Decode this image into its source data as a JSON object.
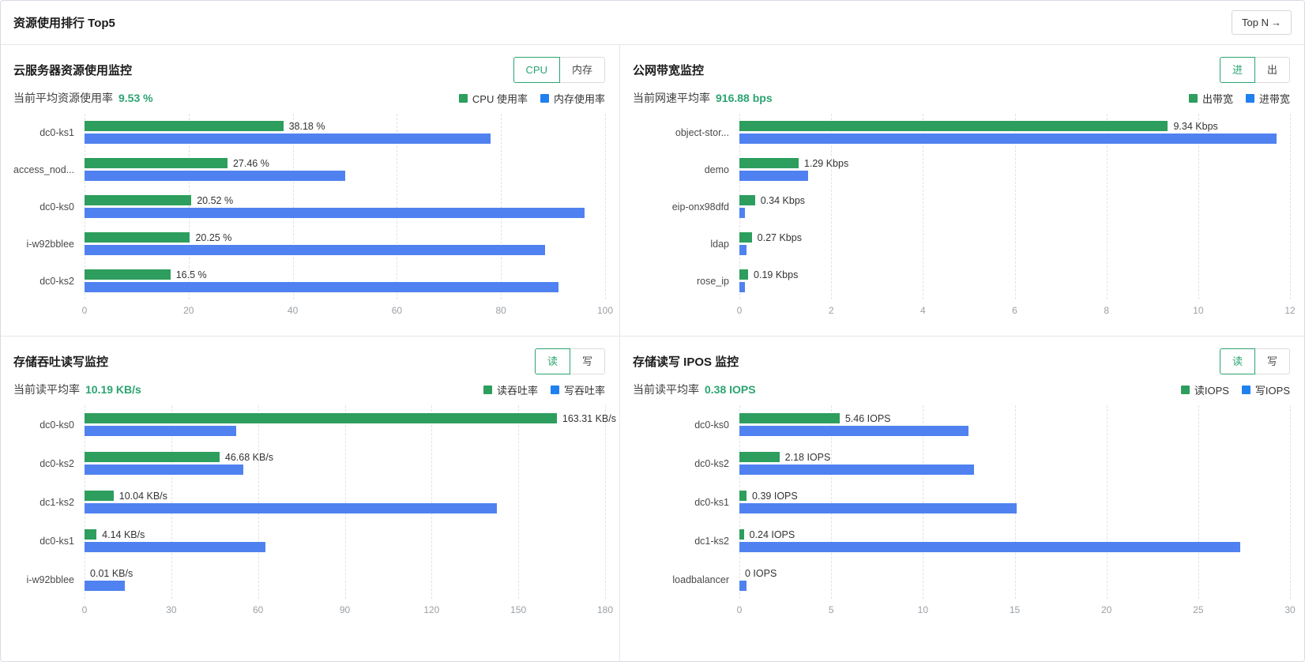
{
  "page": {
    "title": "资源使用排行 Top5",
    "top_n_label": "Top N",
    "top_n_arrow": "→"
  },
  "colors": {
    "bar_green": "#2d9e5d",
    "bar_blue": "#4f82f0",
    "legend_green": "#2d9e5d",
    "legend_blue": "#2080f0",
    "stat_value": "#2ba471",
    "toggle_active": "#2ba471"
  },
  "panels": [
    {
      "id": "cloud-server-usage",
      "title": "云服务器资源使用监控",
      "toggle": {
        "options": [
          "CPU",
          "内存"
        ],
        "active": 0
      },
      "stat_label": "当前平均资源使用率",
      "stat_value": "9.53 %",
      "legend": [
        {
          "label": "CPU 使用率",
          "color": "green"
        },
        {
          "label": "内存使用率",
          "color": "blue"
        }
      ]
    },
    {
      "id": "public-bandwidth",
      "title": "公网带宽监控",
      "toggle": {
        "options": [
          "进",
          "出"
        ],
        "active": 0
      },
      "stat_label": "当前网速平均率",
      "stat_value": "916.88 bps",
      "legend": [
        {
          "label": "出带宽",
          "color": "green"
        },
        {
          "label": "进带宽",
          "color": "blue"
        }
      ]
    },
    {
      "id": "storage-throughput",
      "title": "存储吞吐读写监控",
      "toggle": {
        "options": [
          "读",
          "写"
        ],
        "active": 0
      },
      "stat_label": "当前读平均率",
      "stat_value": "10.19 KB/s",
      "legend": [
        {
          "label": "读吞吐率",
          "color": "green"
        },
        {
          "label": "写吞吐率",
          "color": "blue"
        }
      ]
    },
    {
      "id": "storage-iops",
      "title": "存储读写 IPOS 监控",
      "toggle": {
        "options": [
          "读",
          "写"
        ],
        "active": 0
      },
      "stat_label": "当前读平均率",
      "stat_value": "0.38 IOPS",
      "legend": [
        {
          "label": "读IOPS",
          "color": "green"
        },
        {
          "label": "写IOPS",
          "color": "blue"
        }
      ]
    }
  ],
  "chart_data": [
    {
      "type": "bar",
      "orientation": "horizontal",
      "title": "云服务器资源使用监控",
      "categories": [
        "dc0-ks1",
        "access_nod...",
        "dc0-ks0",
        "i-w92bblee",
        "dc0-ks2"
      ],
      "series": [
        {
          "name": "CPU 使用率",
          "color": "#2d9e5d",
          "values": [
            38.18,
            27.46,
            20.52,
            20.25,
            16.5
          ],
          "labels": [
            "38.18 %",
            "27.46 %",
            "20.52 %",
            "20.25 %",
            "16.5 %"
          ]
        },
        {
          "name": "内存使用率",
          "color": "#4f82f0",
          "values": [
            78,
            50,
            96,
            88.5,
            91
          ]
        }
      ],
      "xticks": [
        0,
        20,
        40,
        60,
        80,
        100
      ],
      "xlim": [
        0,
        100
      ],
      "grid": "dashed-vertical",
      "legend_position": "top-right"
    },
    {
      "type": "bar",
      "orientation": "horizontal",
      "title": "公网带宽监控",
      "categories": [
        "object-stor...",
        "demo",
        "eip-onx98dfd",
        "ldap",
        "rose_ip"
      ],
      "series": [
        {
          "name": "出带宽",
          "color": "#2d9e5d",
          "values": [
            9.34,
            1.29,
            0.34,
            0.27,
            0.19
          ],
          "labels": [
            "9.34 Kbps",
            "1.29 Kbps",
            "0.34 Kbps",
            "0.27 Kbps",
            "0.19 Kbps"
          ]
        },
        {
          "name": "进带宽",
          "color": "#4f82f0",
          "values": [
            11.7,
            1.5,
            0.12,
            0.16,
            0.12
          ]
        }
      ],
      "xticks": [
        0,
        2,
        4,
        6,
        8,
        10,
        12
      ],
      "xlim": [
        0,
        12
      ],
      "grid": "dashed-vertical",
      "legend_position": "top-right"
    },
    {
      "type": "bar",
      "orientation": "horizontal",
      "title": "存储吞吐读写监控",
      "categories": [
        "dc0-ks0",
        "dc0-ks2",
        "dc1-ks2",
        "dc0-ks1",
        "i-w92bblee"
      ],
      "series": [
        {
          "name": "读吞吐率",
          "color": "#2d9e5d",
          "values": [
            163.31,
            46.68,
            10.04,
            4.14,
            0.01
          ],
          "labels": [
            "163.31 KB/s",
            "46.68 KB/s",
            "10.04 KB/s",
            "4.14 KB/s",
            "0.01 KB/s"
          ]
        },
        {
          "name": "写吞吐率",
          "color": "#4f82f0",
          "values": [
            52.5,
            55,
            142.5,
            62.5,
            14
          ]
        }
      ],
      "xticks": [
        0,
        30,
        60,
        90,
        120,
        150,
        180
      ],
      "xlim": [
        0,
        180
      ],
      "grid": "dashed-vertical",
      "legend_position": "top-right"
    },
    {
      "type": "bar",
      "orientation": "horizontal",
      "title": "存储读写 IPOS 监控",
      "categories": [
        "dc0-ks0",
        "dc0-ks2",
        "dc0-ks1",
        "dc1-ks2",
        "loadbalancer"
      ],
      "series": [
        {
          "name": "读IOPS",
          "color": "#2d9e5d",
          "values": [
            5.46,
            2.18,
            0.39,
            0.24,
            0
          ],
          "labels": [
            "5.46 IOPS",
            "2.18 IOPS",
            "0.39 IOPS",
            "0.24 IOPS",
            "0 IOPS"
          ]
        },
        {
          "name": "写IOPS",
          "color": "#4f82f0",
          "values": [
            12.5,
            12.8,
            15.1,
            27.3,
            0.4
          ]
        }
      ],
      "xticks": [
        0,
        5,
        10,
        15,
        20,
        25,
        30
      ],
      "xlim": [
        0,
        30
      ],
      "grid": "dashed-vertical",
      "legend_position": "top-right"
    }
  ]
}
